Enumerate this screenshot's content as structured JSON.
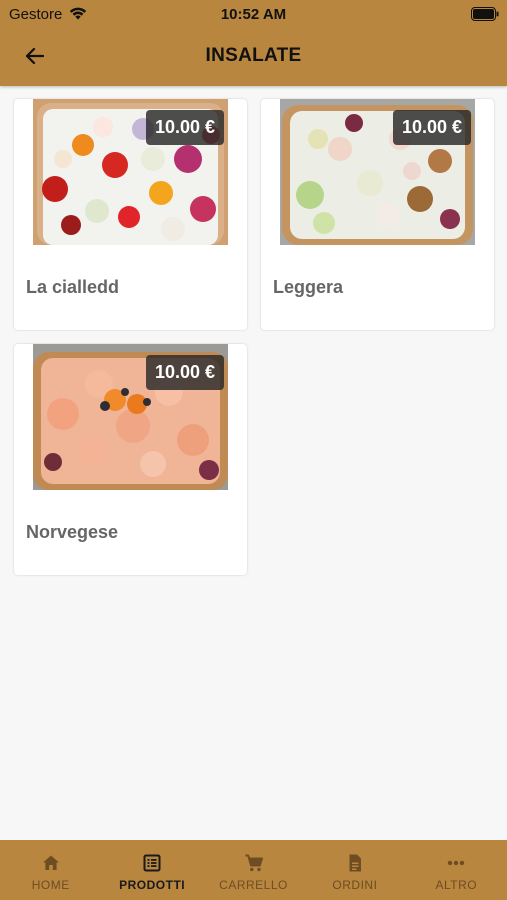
{
  "status_bar": {
    "carrier": "Gestore",
    "time": "10:52 AM"
  },
  "header": {
    "title": "INSALATE",
    "back_icon": "arrow-left-icon"
  },
  "products": [
    {
      "name": "La cialledd",
      "price": "10.00 €",
      "image": "tomato-onion-salad-photo"
    },
    {
      "name": "Leggera",
      "price": "10.00 €",
      "image": "lettuce-walnut-salad-photo"
    },
    {
      "name": "Norvegese",
      "price": "10.00 €",
      "image": "salmon-carrot-salad-photo"
    }
  ],
  "bottom_nav": {
    "active": "PRODOTTI",
    "items": [
      {
        "label": "HOME",
        "icon": "home-icon"
      },
      {
        "label": "PRODOTTI",
        "icon": "list-icon"
      },
      {
        "label": "CARRELLO",
        "icon": "cart-icon"
      },
      {
        "label": "ORDINI",
        "icon": "document-icon"
      },
      {
        "label": "ALTRO",
        "icon": "more-icon"
      }
    ]
  },
  "colors": {
    "brand": "#b8863e",
    "background": "#f7f7f7",
    "nav_inactive": "#6e4d24"
  }
}
